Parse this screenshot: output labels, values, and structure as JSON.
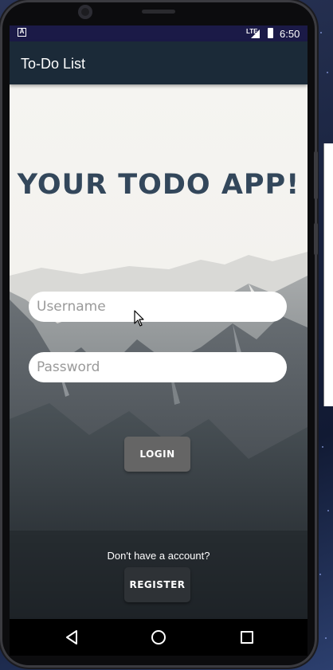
{
  "status_bar": {
    "notification_icon": "A",
    "network_label": "LTE",
    "time": "6:50"
  },
  "app_bar": {
    "title": "To-Do List"
  },
  "login_screen": {
    "headline": "YOUR TODO APP!",
    "username_placeholder": "Username",
    "password_placeholder": "Password",
    "login_label": "LOGIN",
    "register_prompt": "Don't have a account?",
    "register_label": "REGISTER"
  },
  "nav_bar": {
    "back_icon": "triangle-back-icon",
    "home_icon": "circle-home-icon",
    "recents_icon": "square-recents-icon"
  },
  "colors": {
    "app_bar": "#1b2a38",
    "status_bar": "#1b1a47",
    "headline": "#33475b",
    "login_button": "#656565",
    "register_button": "#2e3236"
  }
}
